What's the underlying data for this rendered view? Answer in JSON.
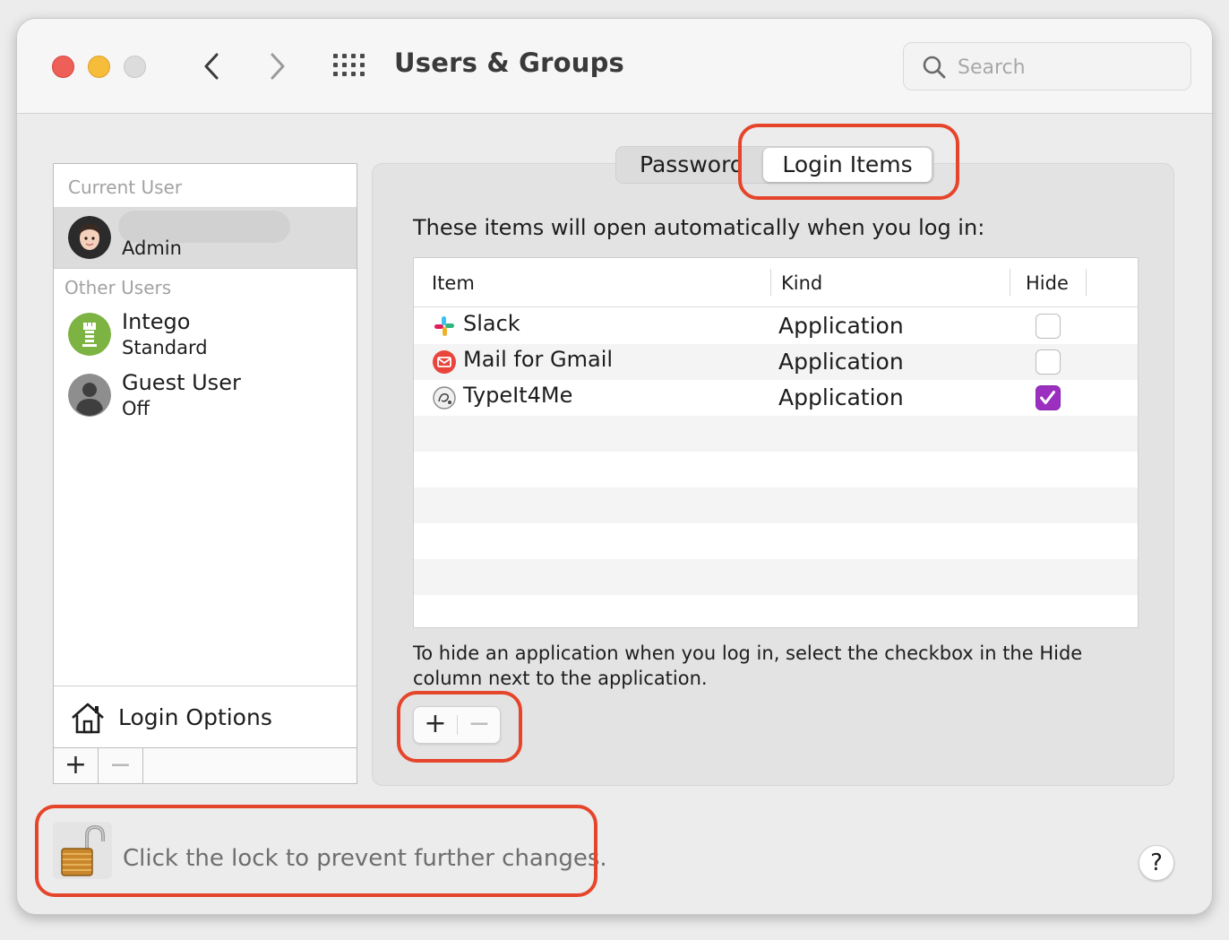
{
  "window": {
    "title": "Users & Groups"
  },
  "search": {
    "placeholder": "Search"
  },
  "sidebar": {
    "current_user_label": "Current User",
    "current_user": {
      "role": "Admin"
    },
    "other_users_label": "Other Users",
    "other_users": [
      {
        "name": "Intego",
        "status": "Standard"
      },
      {
        "name": "Guest User",
        "status": "Off"
      }
    ],
    "login_options_label": "Login Options",
    "add_label": "+",
    "remove_label": "−"
  },
  "tabs": {
    "password": "Password",
    "login_items": "Login Items",
    "active": "Login Items"
  },
  "login_items": {
    "description": "These items will open automatically when you log in:",
    "columns": [
      "Item",
      "Kind",
      "Hide"
    ],
    "rows": [
      {
        "name": "Slack",
        "kind": "Application",
        "hide": false,
        "icon": "slack-icon"
      },
      {
        "name": "Mail for Gmail",
        "kind": "Application",
        "hide": false,
        "icon": "mail-for-gmail-icon"
      },
      {
        "name": "TypeIt4Me",
        "kind": "Application",
        "hide": true,
        "icon": "typeit4me-icon"
      }
    ],
    "help_text": "To hide an application when you log in, select the checkbox in the Hide column next to the application.",
    "add_label": "+",
    "remove_label": "−"
  },
  "footer": {
    "lock_text": "Click the lock to prevent further changes.",
    "help_label": "?"
  },
  "colors": {
    "accent": "#9b30c0",
    "annotation": "#e5452b",
    "close": "#ed5f57",
    "minimize": "#f5bd3a"
  }
}
